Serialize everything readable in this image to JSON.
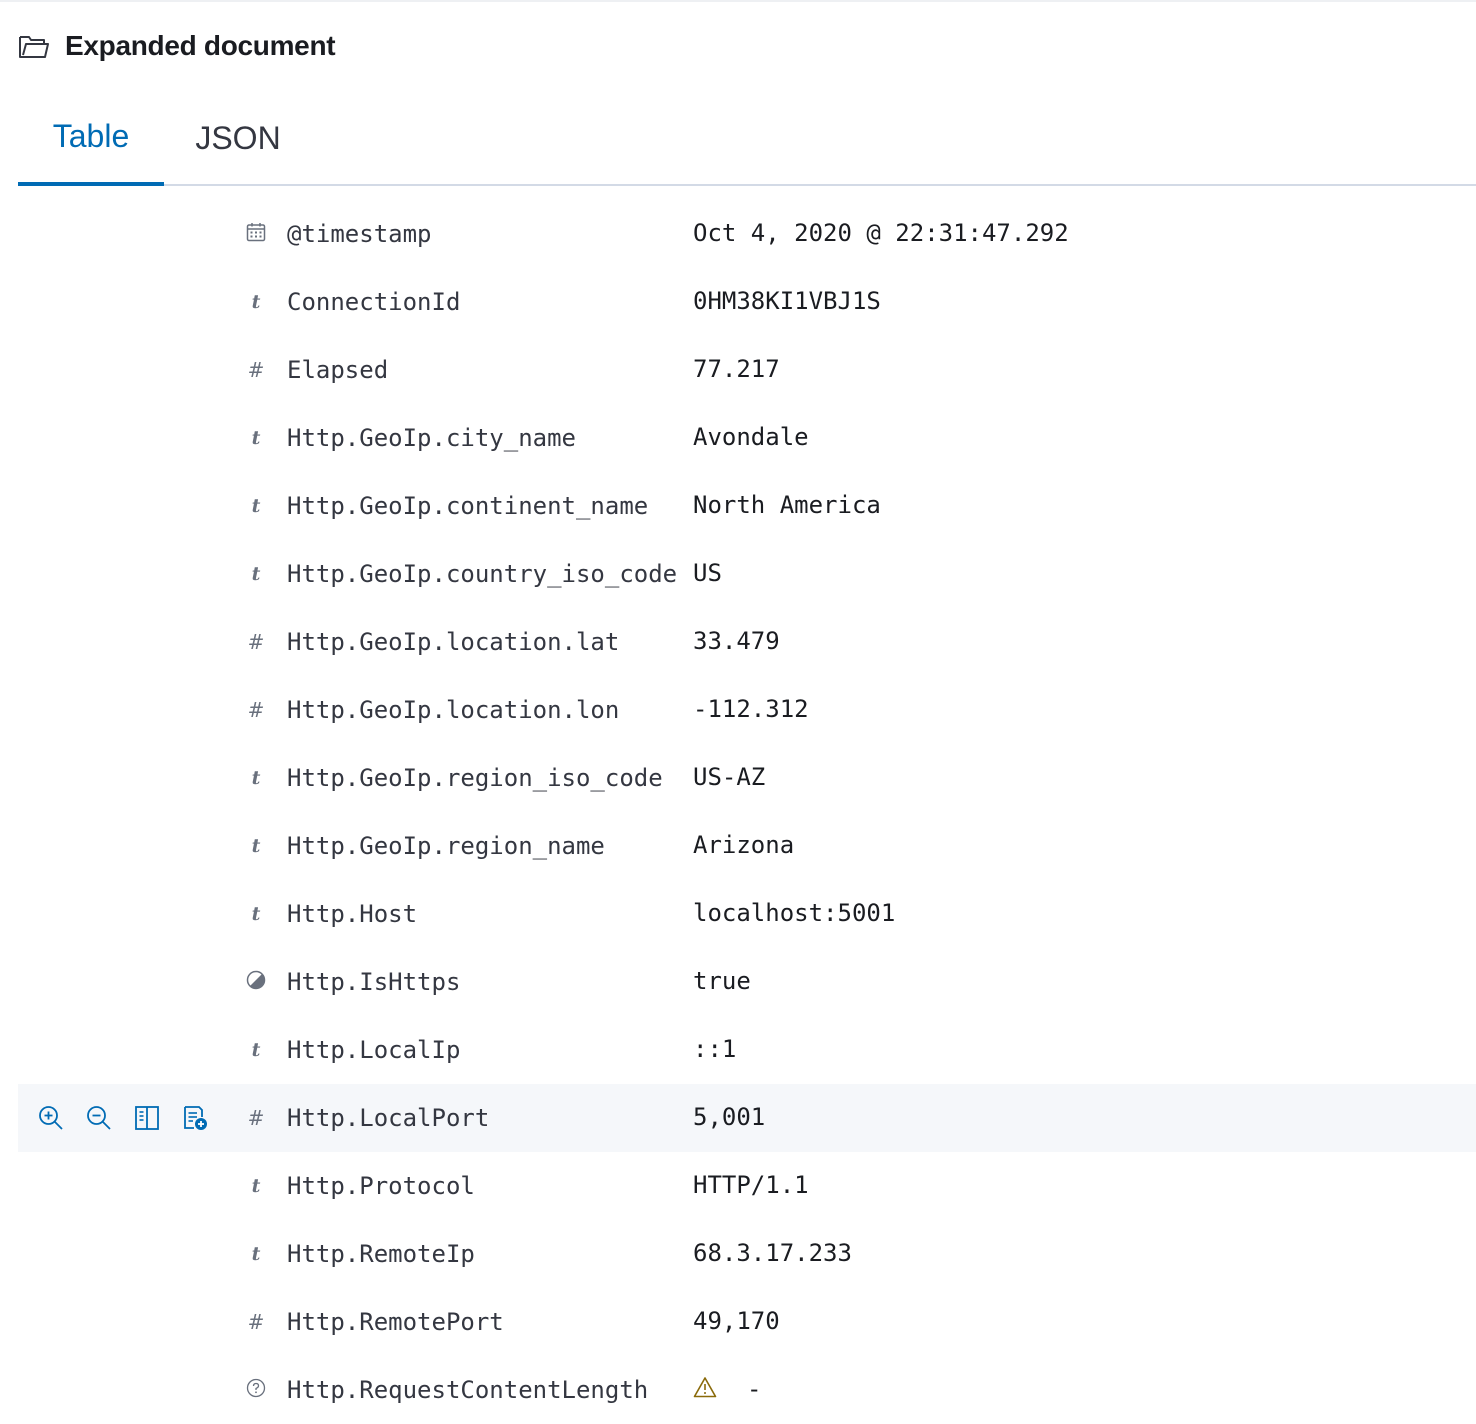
{
  "header": {
    "title": "Expanded document",
    "icon": "folder-open-icon"
  },
  "tabs": [
    {
      "label": "Table",
      "selected": true
    },
    {
      "label": "JSON",
      "selected": false
    }
  ],
  "colors": {
    "accent": "#006bb4",
    "text": "#1a1c21",
    "muted": "#69707d",
    "hover_row": "#f5f7fa",
    "warning": "#8a6a0a"
  },
  "row_actions": [
    "filter-for-value-icon",
    "filter-out-value-icon",
    "toggle-column-icon",
    "filter-for-field-present-icon"
  ],
  "fields": [
    {
      "type": "date",
      "name": "@timestamp",
      "value": "Oct 4, 2020 @ 22:31:47.292"
    },
    {
      "type": "string",
      "name": "ConnectionId",
      "value": "0HM38KI1VBJ1S"
    },
    {
      "type": "number",
      "name": "Elapsed",
      "value": "77.217"
    },
    {
      "type": "string",
      "name": "Http.GeoIp.city_name",
      "value": "Avondale"
    },
    {
      "type": "string",
      "name": "Http.GeoIp.continent_name",
      "value": "North America"
    },
    {
      "type": "string",
      "name": "Http.GeoIp.country_iso_code",
      "value": "US"
    },
    {
      "type": "number",
      "name": "Http.GeoIp.location.lat",
      "value": "33.479"
    },
    {
      "type": "number",
      "name": "Http.GeoIp.location.lon",
      "value": "-112.312"
    },
    {
      "type": "string",
      "name": "Http.GeoIp.region_iso_code",
      "value": "US-AZ"
    },
    {
      "type": "string",
      "name": "Http.GeoIp.region_name",
      "value": "Arizona"
    },
    {
      "type": "string",
      "name": "Http.Host",
      "value": "localhost:5001"
    },
    {
      "type": "boolean",
      "name": "Http.IsHttps",
      "value": "true"
    },
    {
      "type": "string",
      "name": "Http.LocalIp",
      "value": "::1"
    },
    {
      "type": "number",
      "name": "Http.LocalPort",
      "value": "5,001",
      "hover": true
    },
    {
      "type": "string",
      "name": "Http.Protocol",
      "value": "HTTP/1.1"
    },
    {
      "type": "string",
      "name": "Http.RemoteIp",
      "value": "68.3.17.233"
    },
    {
      "type": "number",
      "name": "Http.RemotePort",
      "value": "49,170"
    },
    {
      "type": "unknown",
      "name": "Http.RequestContentLength",
      "value": "-",
      "warning": true
    }
  ],
  "type_glyphs": {
    "string": "t",
    "number": "#"
  }
}
